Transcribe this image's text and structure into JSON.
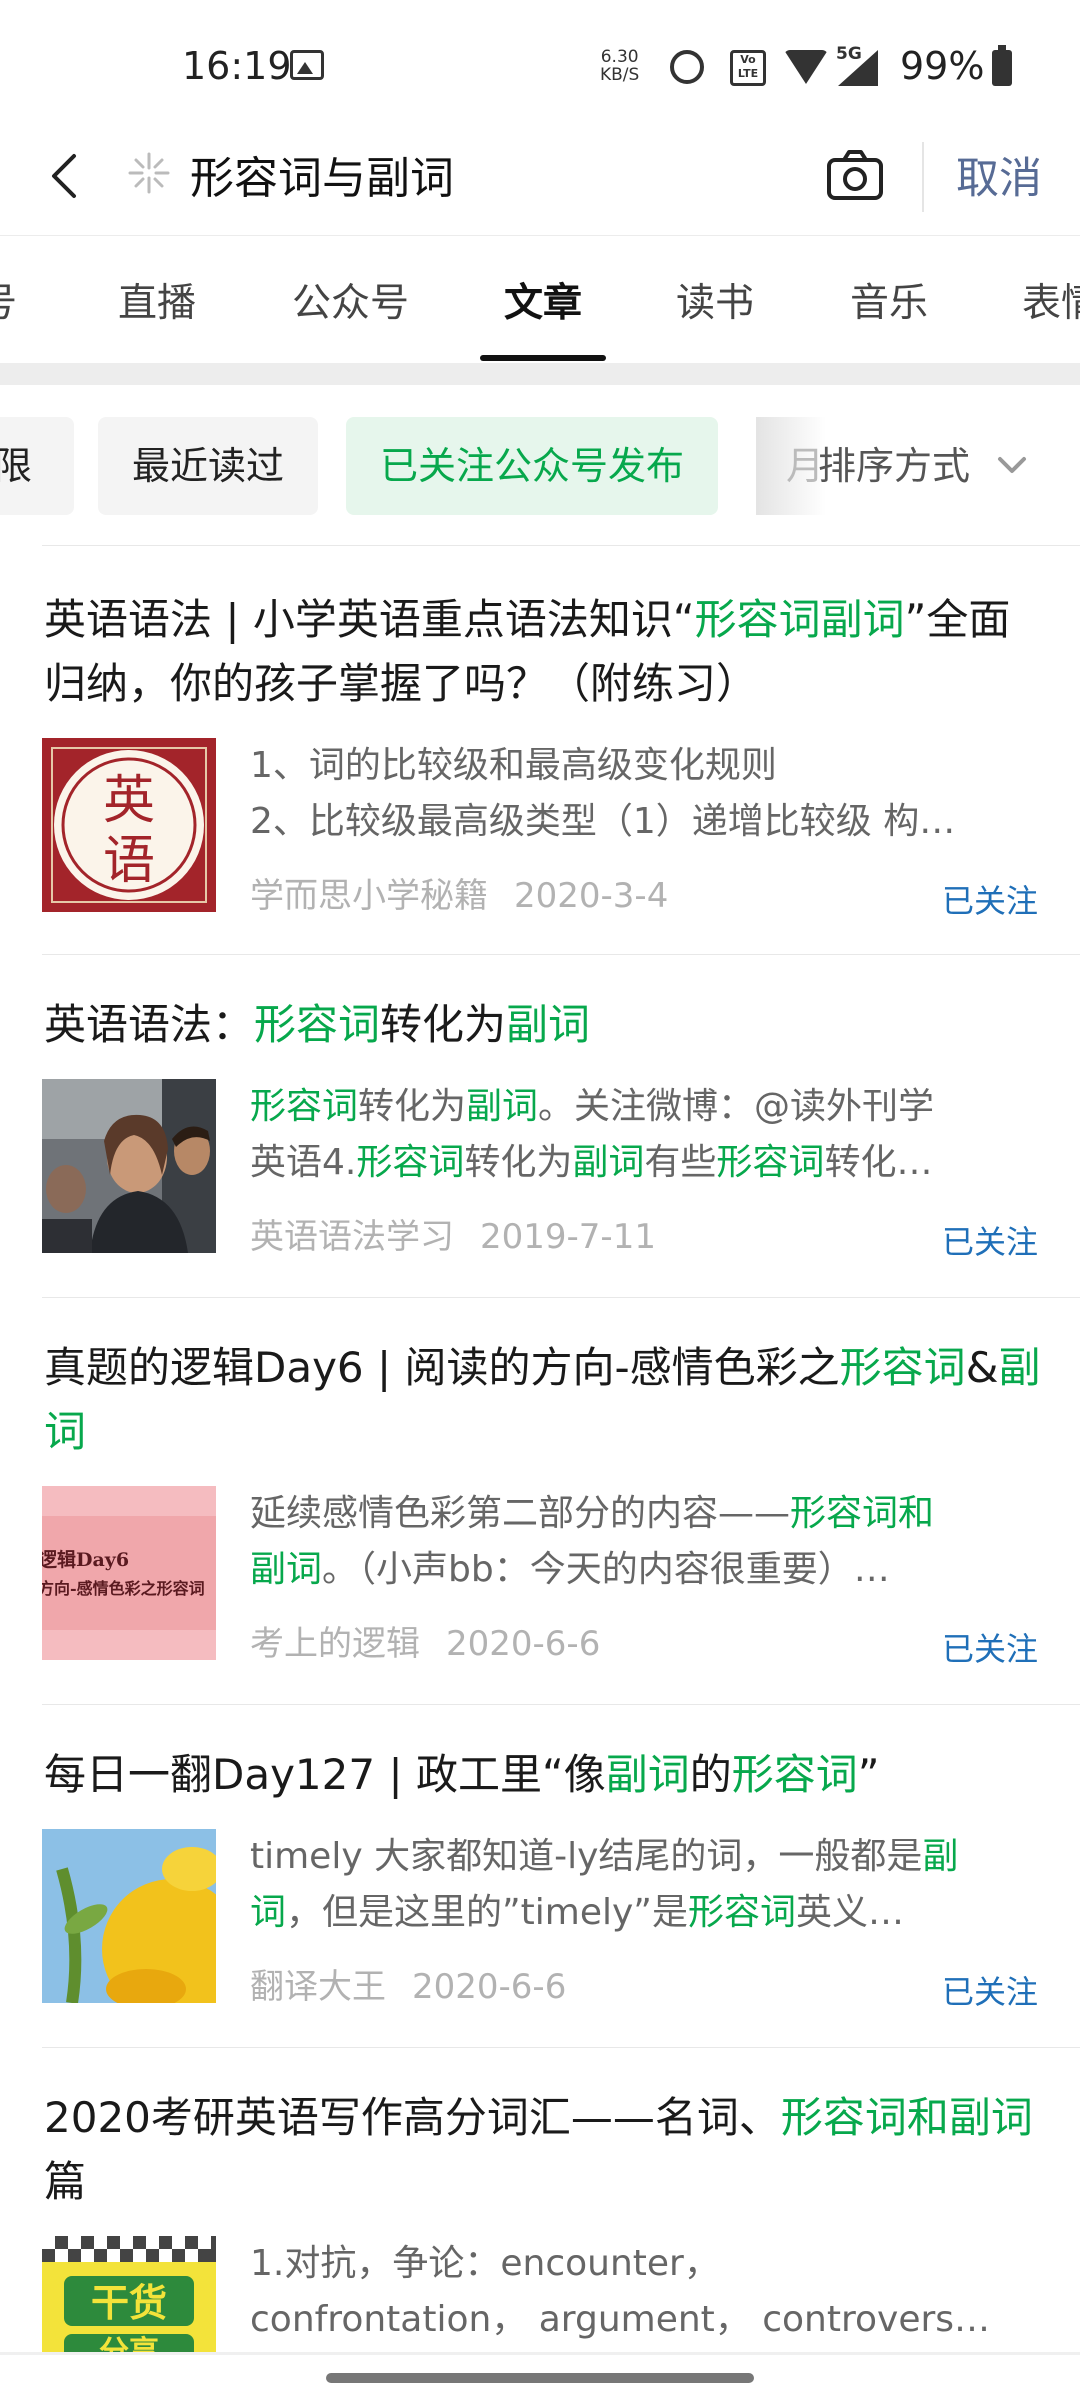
{
  "status_bar": {
    "time": "16:19",
    "net_speed_value": "6.30",
    "net_speed_unit": "KB/S",
    "network": "5G",
    "volte_label": "Vo LTE",
    "battery": "99%",
    "icons": [
      "image-icon",
      "alarm-icon",
      "volte-icon",
      "wifi-icon",
      "signal-icon",
      "battery-icon"
    ]
  },
  "search": {
    "query": "形容词与副词",
    "cancel_label": "取消"
  },
  "tabs": [
    {
      "label": "号",
      "active": false
    },
    {
      "label": "直播",
      "active": false
    },
    {
      "label": "公众号",
      "active": false
    },
    {
      "label": "文章",
      "active": true
    },
    {
      "label": "读书",
      "active": false
    },
    {
      "label": "音乐",
      "active": false
    },
    {
      "label": "表情",
      "active": false
    }
  ],
  "filters": {
    "chips": [
      "限",
      "最近读过",
      "已关注公众号发布"
    ],
    "partial_chip": "月",
    "sort_label": "排序方式"
  },
  "results": [
    {
      "title": [
        {
          "t": "英语语法 | 小学英语重点语法知识“",
          "h": false
        },
        {
          "t": "形容词副词",
          "h": true
        },
        {
          "t": "”全面归纳，你的孩子掌握了吗？（附练习）",
          "h": false
        }
      ],
      "thumb_text": [
        "英",
        "语"
      ],
      "snippet_lines": [
        [
          {
            "t": "1、词的比较级和最高级变化规则",
            "h": false
          }
        ],
        [
          {
            "t": "2、比较级最高级类型（1）递增比较级 构…",
            "h": false
          }
        ]
      ],
      "source": "学而思小学秘籍",
      "date": "2020-3-4",
      "follow_label": "已关注"
    },
    {
      "title": [
        {
          "t": "英语语法：",
          "h": false
        },
        {
          "t": "形容词",
          "h": true
        },
        {
          "t": "转化为",
          "h": false
        },
        {
          "t": "副词",
          "h": true
        }
      ],
      "snippet_lines": [
        [
          {
            "t": "形容词",
            "h": true
          },
          {
            "t": "转化为",
            "h": false
          },
          {
            "t": "副词",
            "h": true
          },
          {
            "t": "。关注微博：@读外刊学",
            "h": false
          }
        ],
        [
          {
            "t": "英语4.",
            "h": false
          },
          {
            "t": "形容词",
            "h": true
          },
          {
            "t": "转化为",
            "h": false
          },
          {
            "t": "副词",
            "h": true
          },
          {
            "t": "有些",
            "h": false
          },
          {
            "t": "形容词",
            "h": true
          },
          {
            "t": "转化…",
            "h": false
          }
        ]
      ],
      "source": "英语语法学习",
      "date": "2019-7-11",
      "follow_label": "已关注"
    },
    {
      "title": [
        {
          "t": "真题的逻辑Day6 | 阅读的方向-感情色彩之",
          "h": false
        },
        {
          "t": "形容词",
          "h": true
        },
        {
          "t": "&",
          "h": false
        },
        {
          "t": "副词",
          "h": true
        }
      ],
      "thumb_text": [
        "逻辑Day6",
        "方向-感情色彩之形容词"
      ],
      "snippet_lines": [
        [
          {
            "t": "延续感情色彩第二部分的内容——",
            "h": false
          },
          {
            "t": "形容词和",
            "h": true
          }
        ],
        [
          {
            "t": "副词",
            "h": true
          },
          {
            "t": "。（小声bb：今天的内容很重要）…",
            "h": false
          }
        ]
      ],
      "source": "考上的逻辑",
      "date": "2020-6-6",
      "follow_label": "已关注"
    },
    {
      "title": [
        {
          "t": "每日一翻Day127 | 政工里“像",
          "h": false
        },
        {
          "t": "副词",
          "h": true
        },
        {
          "t": "的",
          "h": false
        },
        {
          "t": "形容词",
          "h": true
        },
        {
          "t": "”",
          "h": false
        }
      ],
      "snippet_lines": [
        [
          {
            "t": "timely 大家都知道-ly结尾的词，一般都是",
            "h": false
          },
          {
            "t": "副",
            "h": true
          }
        ],
        [
          {
            "t": "词",
            "h": true
          },
          {
            "t": "，但是这里的”timely”是",
            "h": false
          },
          {
            "t": "形容词",
            "h": true
          },
          {
            "t": "英义…",
            "h": false
          }
        ]
      ],
      "source": "翻译大王",
      "date": "2020-6-6",
      "follow_label": "已关注"
    },
    {
      "title": [
        {
          "t": "2020考研英语写作高分词汇——名词、",
          "h": false
        },
        {
          "t": "形容词和",
          "h": true
        },
        {
          "t": "副词",
          "h": true
        },
        {
          "t": "篇",
          "h": false
        }
      ],
      "thumb_text": [
        "干货",
        "分享"
      ],
      "snippet_lines": [
        [
          {
            "t": "1.对抗，争论：encounter，",
            "h": false
          }
        ],
        [
          {
            "t": "confrontation， argument， controvers…",
            "h": false
          }
        ]
      ],
      "source": "",
      "date": "",
      "follow_label": ""
    }
  ],
  "colors": {
    "highlight": "#07a84c",
    "link": "#576b95",
    "followed": "#1f6fb8",
    "chip_active_bg": "#e6f6ec"
  }
}
